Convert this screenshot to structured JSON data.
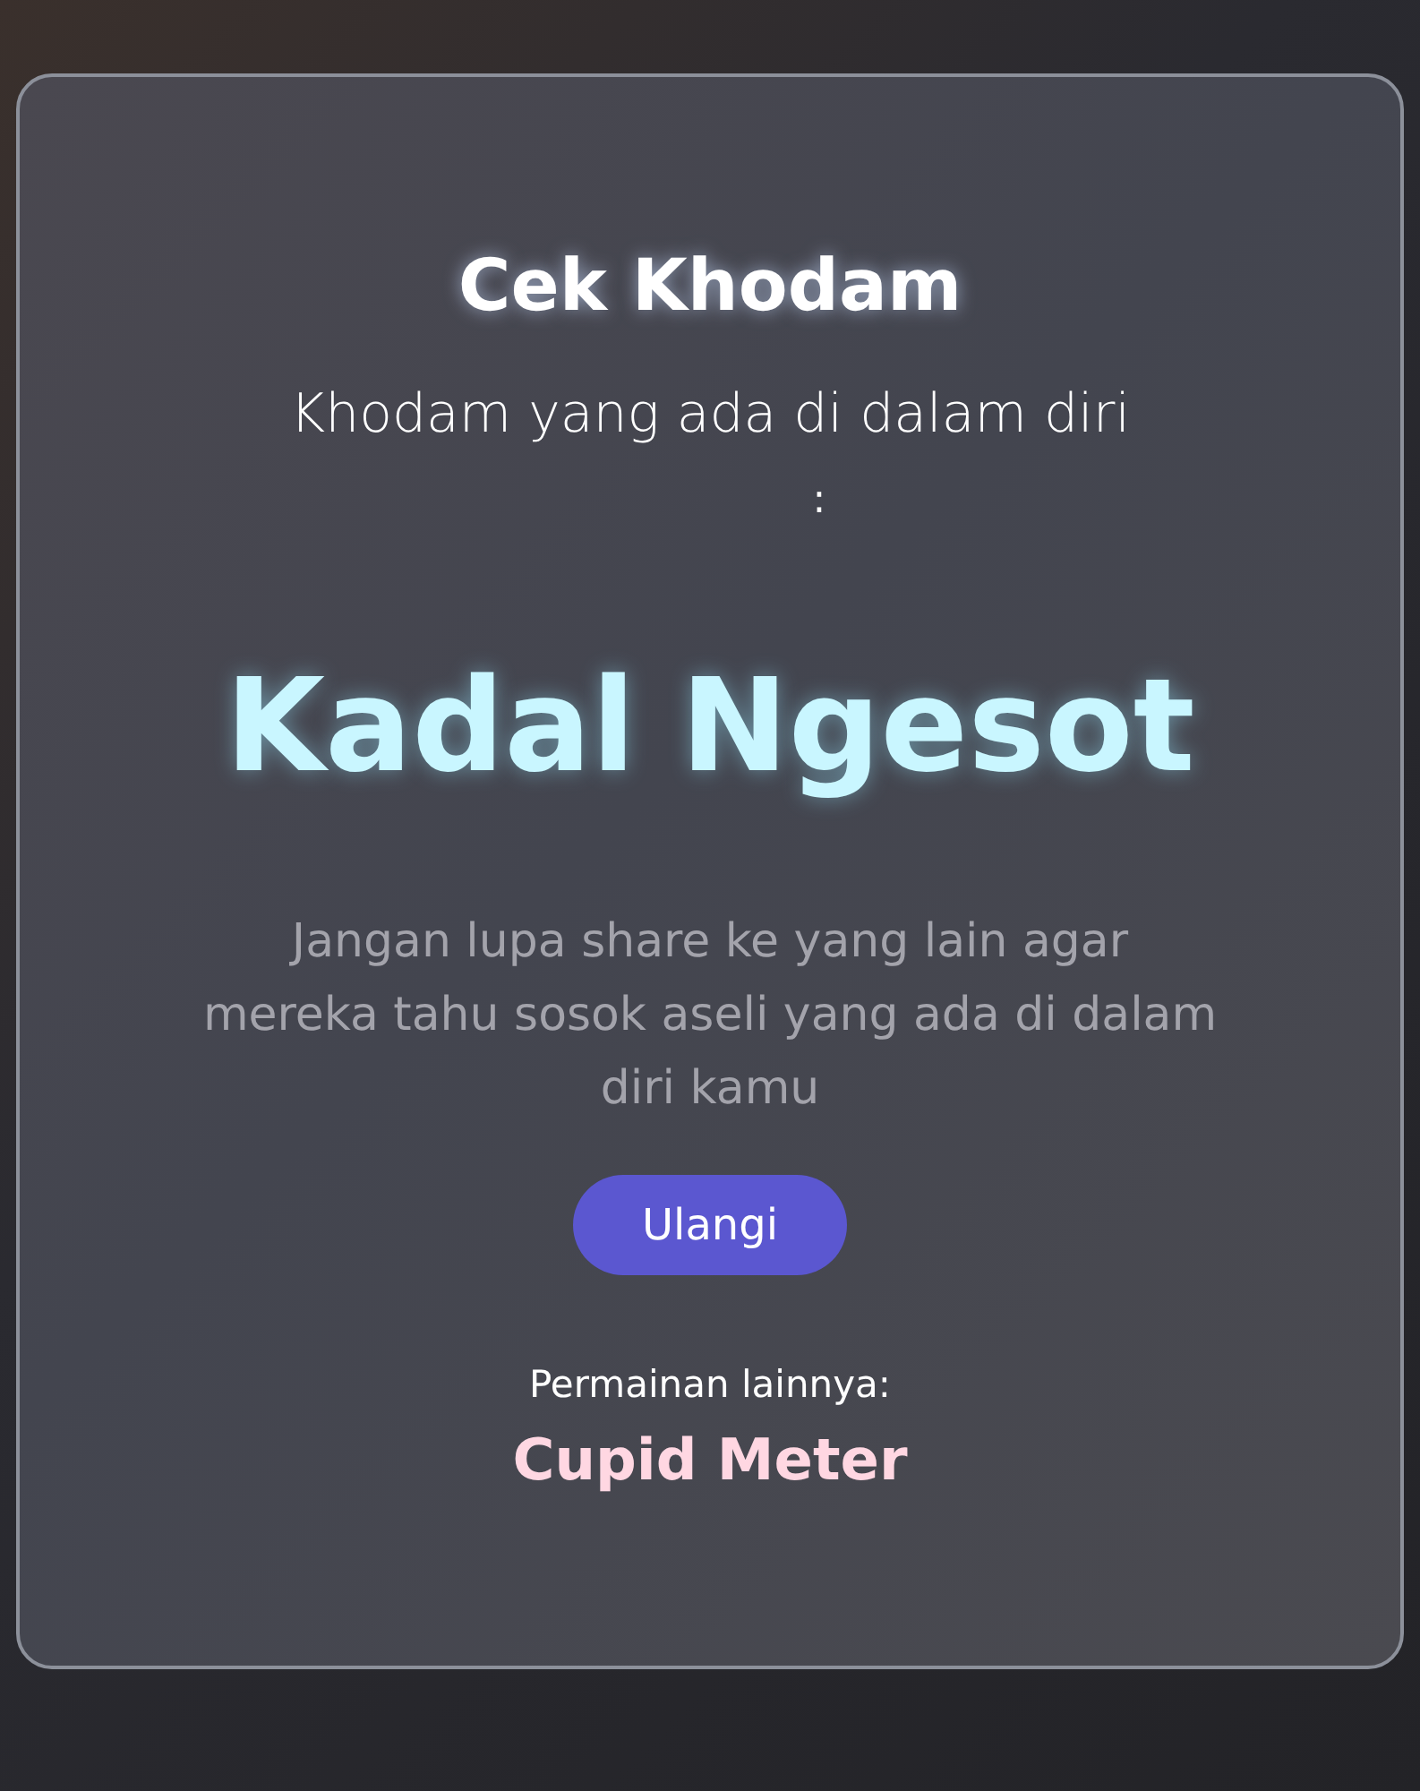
{
  "title": "Cek Khodam",
  "subtitle": "Khodam yang ada di dalam diri",
  "separator": ":",
  "result": "Kadal Ngesot",
  "message": "Jangan lupa share ke yang lain agar mereka tahu sosok aseli yang ada di dalam diri kamu",
  "retry_button": "Ulangi",
  "other_games": {
    "label": "Permainan lainnya:",
    "links": [
      "Cupid Meter"
    ]
  }
}
